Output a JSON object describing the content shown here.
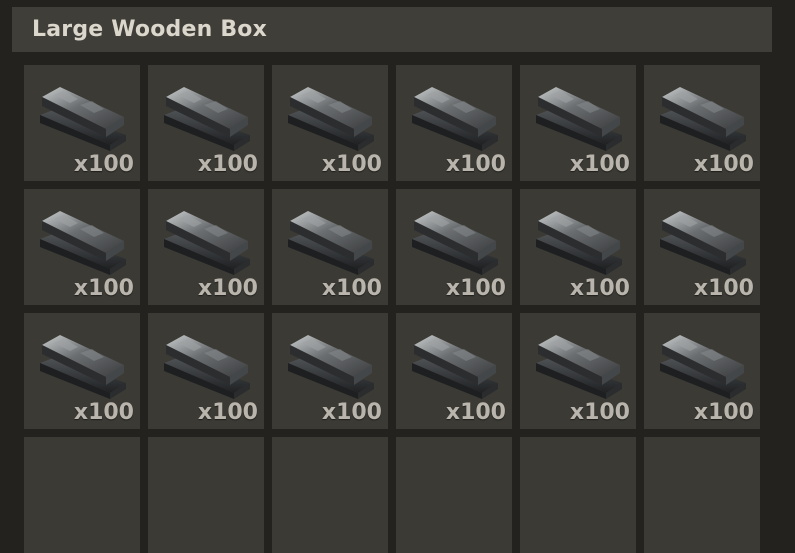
{
  "container": {
    "title": "Large Wooden Box"
  },
  "inventory": {
    "item_icon": "metal-ingot-icon",
    "slots": [
      {
        "qty": "x100"
      },
      {
        "qty": "x100"
      },
      {
        "qty": "x100"
      },
      {
        "qty": "x100"
      },
      {
        "qty": "x100"
      },
      {
        "qty": "x100"
      },
      {
        "qty": "x100"
      },
      {
        "qty": "x100"
      },
      {
        "qty": "x100"
      },
      {
        "qty": "x100"
      },
      {
        "qty": "x100"
      },
      {
        "qty": "x100"
      },
      {
        "qty": "x100"
      },
      {
        "qty": "x100"
      },
      {
        "qty": "x100"
      },
      {
        "qty": "x100"
      },
      {
        "qty": "x100"
      },
      {
        "qty": "x100"
      },
      {
        "qty": ""
      },
      {
        "qty": ""
      },
      {
        "qty": ""
      },
      {
        "qty": ""
      },
      {
        "qty": ""
      },
      {
        "qty": ""
      }
    ]
  },
  "colors": {
    "background": "#23221e",
    "header": "#3f3e38",
    "slot": "#3b3a35",
    "text": "#dcd7cc",
    "qty_text": "#b9b5ad"
  }
}
